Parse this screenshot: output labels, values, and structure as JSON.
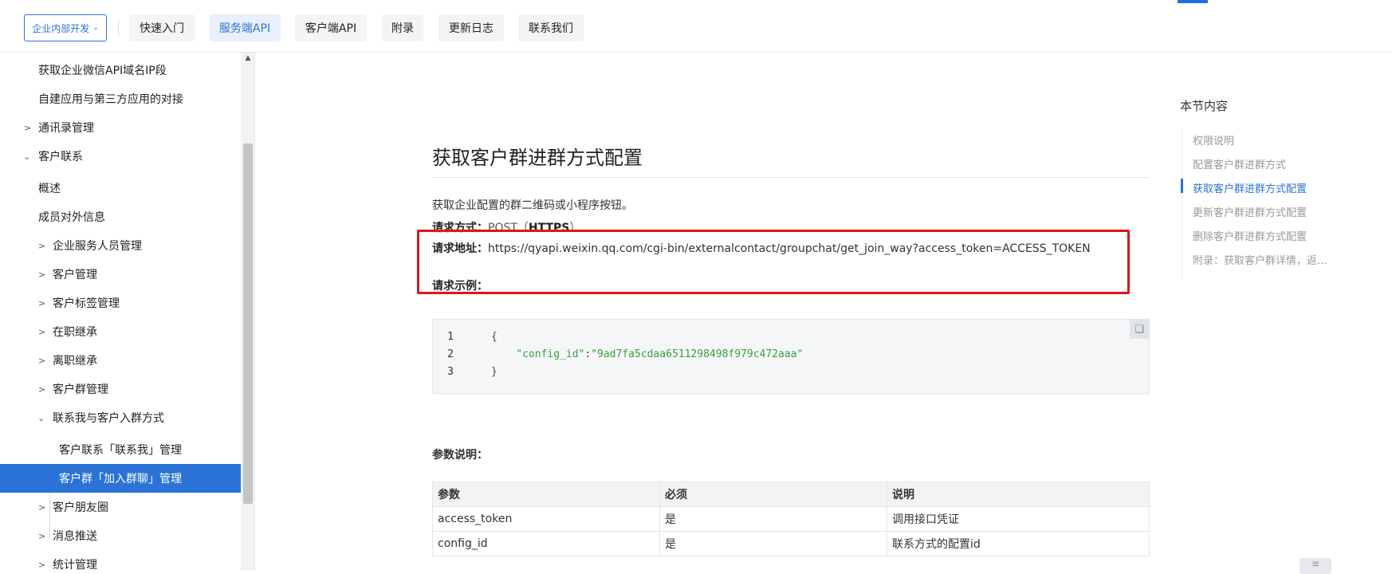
{
  "nav": {
    "brand_label": "企业内部开发",
    "tabs": [
      {
        "label": "快速入门",
        "active": false
      },
      {
        "label": "服务端API",
        "active": true
      },
      {
        "label": "客户端API",
        "active": false
      },
      {
        "label": "附录",
        "active": false
      },
      {
        "label": "更新日志",
        "active": false
      },
      {
        "label": "联系我们",
        "active": false
      }
    ]
  },
  "sidebar": {
    "items": [
      {
        "label": "获取企业微信API域名IP段",
        "chevron": "none"
      },
      {
        "label": "自建应用与第三方应用的对接",
        "chevron": "none"
      },
      {
        "label": "通讯录管理",
        "chevron": "right"
      },
      {
        "label": "客户联系",
        "chevron": "down"
      },
      {
        "label": "概述",
        "chevron": "none"
      },
      {
        "label": "成员对外信息",
        "chevron": "none"
      },
      {
        "label": "企业服务人员管理",
        "chevron": "right"
      },
      {
        "label": "客户管理",
        "chevron": "right"
      },
      {
        "label": "客户标签管理",
        "chevron": "right"
      },
      {
        "label": "在职继承",
        "chevron": "right"
      },
      {
        "label": "离职继承",
        "chevron": "right"
      },
      {
        "label": "客户群管理",
        "chevron": "right"
      },
      {
        "label": "联系我与客户入群方式",
        "chevron": "down"
      },
      {
        "label": "客户联系「联系我」管理",
        "chevron": "none"
      },
      {
        "label": "客户群「加入群聊」管理",
        "chevron": "none",
        "active": true
      },
      {
        "label": "客户朋友圈",
        "chevron": "right"
      },
      {
        "label": "消息推送",
        "chevron": "right"
      },
      {
        "label": "统计管理",
        "chevron": "right"
      }
    ]
  },
  "main": {
    "title": "获取客户群进群方式配置",
    "description": "获取企业配置的群二维码或小程序按钮。",
    "method_label": "请求方式：",
    "method_value": "POST（",
    "method_proto": "HTTPS",
    "method_close": "）",
    "url_label": "请求地址：",
    "url_value": "https://qyapi.weixin.qq.com/cgi-bin/externalcontact/groupchat/get_join_way?access_token=ACCESS_TOKEN",
    "example_label": "请求示例：",
    "code": {
      "line1_num": "1",
      "line1": "{",
      "line2_num": "2",
      "line2_key": "\"config_id\"",
      "line2_colon": ":",
      "line2_val": "\"9ad7fa5cdaa6511298498f979c472aaa\"",
      "line3_num": "3",
      "line3": "}"
    },
    "params_title": "参数说明：",
    "params_headers": [
      "参数",
      "必须",
      "说明"
    ],
    "params_rows": [
      [
        "access_token",
        "是",
        "调用接口凭证"
      ],
      [
        "config_id",
        "是",
        "联系方式的配置id"
      ]
    ]
  },
  "toc": {
    "title": "本节内容",
    "items": [
      {
        "label": "权限说明",
        "active": false
      },
      {
        "label": "配置客户群进群方式",
        "active": false
      },
      {
        "label": "获取客户群进群方式配置",
        "active": true
      },
      {
        "label": "更新客户群进群方式配置",
        "active": false
      },
      {
        "label": "删除客户群进群方式配置",
        "active": false
      },
      {
        "label": "附录：获取客户群详情，返...",
        "active": false
      }
    ]
  },
  "colors": {
    "accent": "#2b73d6",
    "highlight_border": "#e0141a",
    "code_string": "#3a9d3a"
  }
}
